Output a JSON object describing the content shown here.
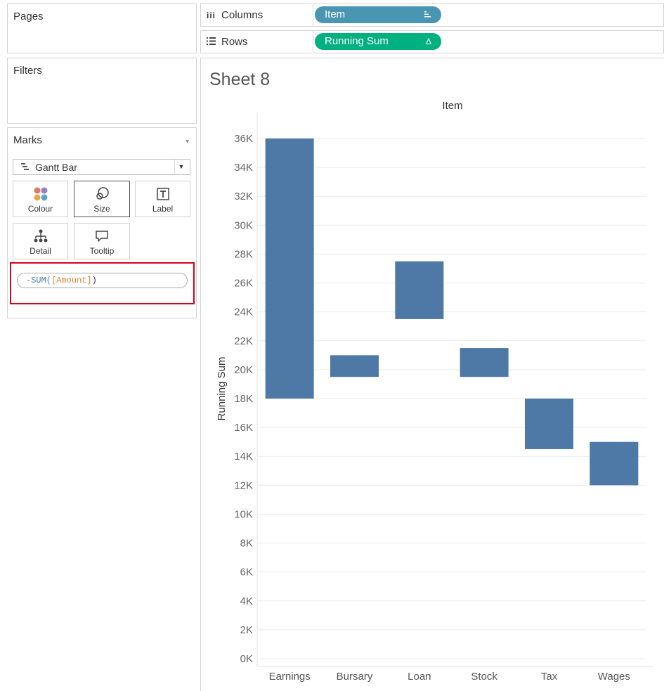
{
  "left_pane": {
    "pages_title": "Pages",
    "filters_title": "Filters",
    "marks": {
      "title": "Marks",
      "mark_type": "Gantt Bar",
      "buttons": [
        {
          "label": "Colour",
          "icon": "colour-dots-icon"
        },
        {
          "label": "Size",
          "icon": "size-circles-icon"
        },
        {
          "label": "Label",
          "icon": "label-t-icon"
        },
        {
          "label": "Detail",
          "icon": "detail-tree-icon"
        },
        {
          "label": "Tooltip",
          "icon": "tooltip-speech-icon"
        }
      ],
      "size_field": {
        "prefix": "-SUM(",
        "field": "[Amount]",
        "suffix": ")"
      }
    }
  },
  "shelves": {
    "columns": {
      "label": "Columns",
      "pill": "Item",
      "pill_icon": "sort-icon"
    },
    "rows": {
      "label": "Rows",
      "pill": "Running Sum",
      "pill_icon": "Δ"
    }
  },
  "colors": {
    "columns_pill": "#4996b2",
    "rows_pill": "#00b180",
    "bar": "#4e79a7",
    "highlight_border": "#d9001b"
  },
  "sheet": {
    "title": "Sheet 8"
  },
  "chart_data": {
    "type": "bar",
    "subtype": "gantt-waterfall",
    "title": "",
    "xlabel": "Item",
    "ylabel": "Running Sum",
    "categories": [
      "Earnings",
      "Bursary",
      "Loan",
      "Stock",
      "Tax",
      "Wages"
    ],
    "bars": [
      {
        "category": "Earnings",
        "start": 18000,
        "end": 36000
      },
      {
        "category": "Bursary",
        "start": 19500,
        "end": 21000
      },
      {
        "category": "Loan",
        "start": 23500,
        "end": 27500
      },
      {
        "category": "Stock",
        "start": 19500,
        "end": 21500
      },
      {
        "category": "Tax",
        "start": 14500,
        "end": 18000
      },
      {
        "category": "Wages",
        "start": 12000,
        "end": 15000
      }
    ],
    "ylim": [
      0,
      36000
    ],
    "yticks": [
      0,
      2000,
      4000,
      6000,
      8000,
      10000,
      12000,
      14000,
      16000,
      18000,
      20000,
      22000,
      24000,
      26000,
      28000,
      30000,
      32000,
      34000,
      36000
    ],
    "ytick_labels": [
      "0K",
      "2K",
      "4K",
      "6K",
      "8K",
      "10K",
      "12K",
      "14K",
      "16K",
      "18K",
      "20K",
      "22K",
      "24K",
      "26K",
      "28K",
      "30K",
      "32K",
      "34K",
      "36K"
    ],
    "grid": true,
    "legend": "none"
  }
}
